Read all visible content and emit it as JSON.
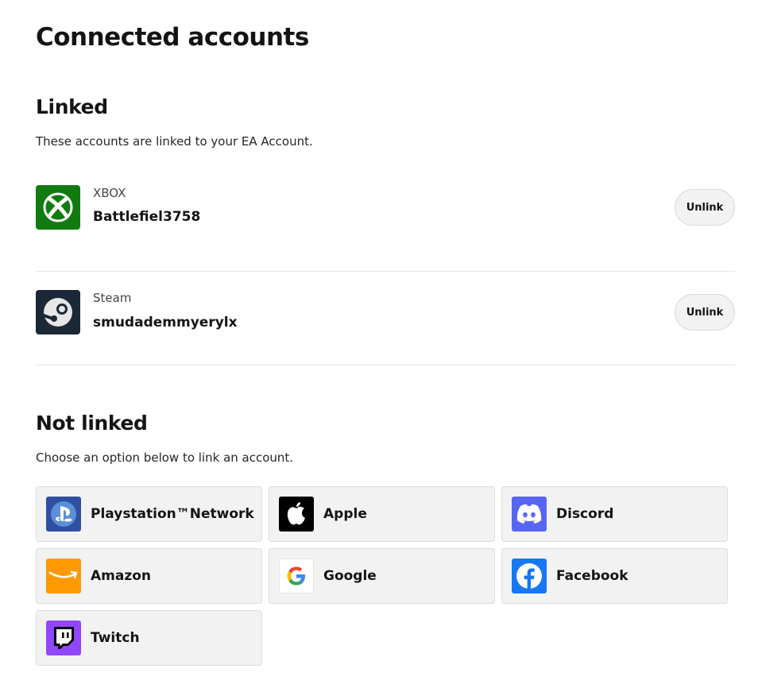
{
  "page": {
    "title": "Connected accounts"
  },
  "linked": {
    "title": "Linked",
    "description": "These accounts are linked to your EA Account.",
    "accounts": [
      {
        "platform": "XBOX",
        "username": "Battlefiel3758",
        "action": "Unlink",
        "icon": "xbox-icon",
        "color": "#107c10"
      },
      {
        "platform": "Steam",
        "username": "smudademmyerylx",
        "action": "Unlink",
        "icon": "steam-icon",
        "color": "#1b2838"
      }
    ]
  },
  "not_linked": {
    "title": "Not linked",
    "description": "Choose an option below to link an account.",
    "options": [
      {
        "label": "Playstation™Network",
        "icon": "playstation-icon",
        "color": "#2f4fa2"
      },
      {
        "label": "Apple",
        "icon": "apple-icon",
        "color": "#000000"
      },
      {
        "label": "Discord",
        "icon": "discord-icon",
        "color": "#5865f2"
      },
      {
        "label": "Amazon",
        "icon": "amazon-icon",
        "color": "#ff9900"
      },
      {
        "label": "Google",
        "icon": "google-icon",
        "color": "#ffffff"
      },
      {
        "label": "Facebook",
        "icon": "facebook-icon",
        "color": "#1877f2"
      },
      {
        "label": "Twitch",
        "icon": "twitch-icon",
        "color": "#9146ff"
      }
    ]
  }
}
